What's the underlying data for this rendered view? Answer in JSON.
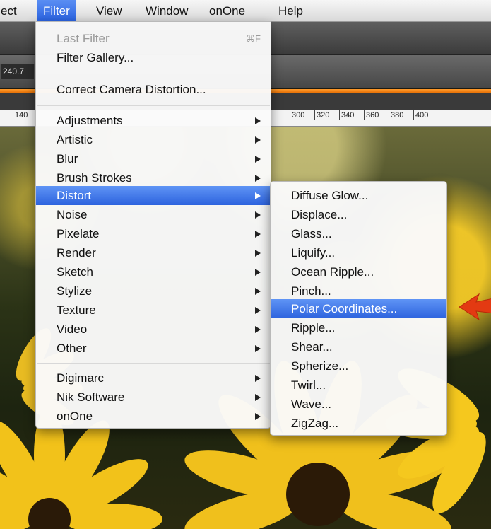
{
  "menubar": {
    "items": [
      "ect",
      "Filter",
      "View",
      "Window",
      "onOne",
      "Help"
    ],
    "active": "Filter"
  },
  "toolbar": {
    "readout": "240.7"
  },
  "ruler": {
    "ticks": [
      "140",
      "300",
      "320",
      "340",
      "360",
      "380",
      "400"
    ]
  },
  "filter_menu": {
    "last_filter": "Last Filter",
    "last_filter_shortcut": "⌘F",
    "filter_gallery": "Filter Gallery...",
    "correct_camera": "Correct Camera Distortion...",
    "groups": [
      "Adjustments",
      "Artistic",
      "Blur",
      "Brush Strokes",
      "Distort",
      "Noise",
      "Pixelate",
      "Render",
      "Sketch",
      "Stylize",
      "Texture",
      "Video",
      "Other"
    ],
    "plugins": [
      "Digimarc",
      "Nik Software",
      "onOne"
    ],
    "highlighted": "Distort"
  },
  "distort_submenu": {
    "items": [
      "Diffuse Glow...",
      "Displace...",
      "Glass...",
      "Liquify...",
      "Ocean Ripple...",
      "Pinch...",
      "Polar Coordinates...",
      "Ripple...",
      "Shear...",
      "Spherize...",
      "Twirl...",
      "Wave...",
      "ZigZag..."
    ],
    "highlighted": "Polar Coordinates..."
  },
  "colors": {
    "highlight": "#2d63de",
    "annotation_arrow": "#e33a12",
    "accent_orange": "#e26a00"
  }
}
